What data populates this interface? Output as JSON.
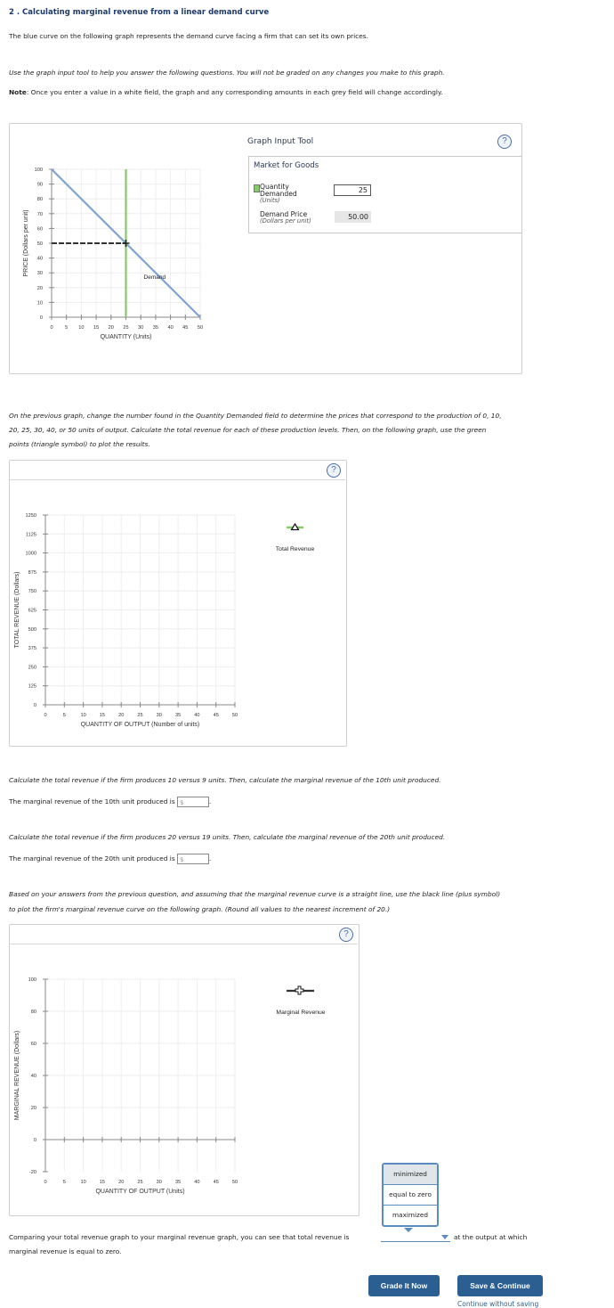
{
  "header": {
    "title": "2 . Calculating marginal revenue from a linear demand curve",
    "intro": "The blue curve on the following graph represents the demand curve facing a firm that can set its own prices.",
    "instruction": "Use the graph input tool to help you answer the following questions. You will not be graded on any changes you make to this graph.",
    "note_label": "Note",
    "note_text": ": Once you enter a value in a white field, the graph and any corresponding amounts in each grey field will change accordingly."
  },
  "graph_input_tool": {
    "title": "Graph Input Tool",
    "help": "?",
    "market_title": "Market for Goods",
    "quantity_label": "Quantity",
    "quantity_label2": "Demanded",
    "quantity_unit": "(Units)",
    "quantity_value": "25",
    "price_label": "Demand Price",
    "price_unit": "(Dollars per unit)",
    "price_value": "50.00"
  },
  "task2_text": {
    "line1": "On the previous graph, change the number found in the Quantity Demanded field to determine the prices that correspond to the production of 0, 10,",
    "line2": "20, 25, 30, 40, or 50 units of output. Calculate the total revenue for each of these production levels. Then, on the following graph, use the green",
    "line3": "points (triangle symbol) to plot the results."
  },
  "q10": {
    "prompt": "Calculate the total revenue if the firm produces 10 versus 9 units. Then, calculate the marginal revenue of the 10th unit produced.",
    "answer_label": "The marginal revenue of the 10th unit produced is",
    "prefix": "$",
    "value": "",
    "suffix": "."
  },
  "q20": {
    "prompt": "Calculate the total revenue if the firm produces 20 versus 19 units. Then, calculate the marginal revenue of the 20th unit produced.",
    "answer_label": "The marginal revenue of the 20th unit produced is",
    "prefix": "$",
    "value": "",
    "suffix": "."
  },
  "mr_text": {
    "line1": "Based on your answers from the previous question, and assuming that the marginal revenue curve is a straight line, use the black line (plus symbol)",
    "line2": "to plot the firm's marginal revenue curve on the following graph. (Round all values to the nearest increment of 20.)"
  },
  "comparison": {
    "before": "Comparing your total revenue graph to your marginal revenue graph, you can see that total revenue is",
    "after": "at the output at which",
    "line2": "marginal revenue is equal to zero.",
    "selected": "",
    "options": [
      "minimized",
      "equal to zero",
      "maximized"
    ]
  },
  "buttons": {
    "grade": "Grade It Now",
    "save": "Save & Continue",
    "continue_link": "Continue without saving"
  },
  "help_icon": "?",
  "chart_data": [
    {
      "type": "line",
      "title": "",
      "xlabel": "QUANTITY (Units)",
      "ylabel": "PRICE (Dollars per unit)",
      "xlim": [
        0,
        50
      ],
      "ylim": [
        0,
        100
      ],
      "xticks": [
        0,
        5,
        10,
        15,
        20,
        25,
        30,
        35,
        40,
        45,
        50
      ],
      "yticks": [
        0,
        10,
        20,
        30,
        40,
        50,
        60,
        70,
        80,
        90,
        100
      ],
      "grid": true,
      "series": [
        {
          "name": "Demand",
          "color": "#7fa4d2",
          "x": [
            0,
            50
          ],
          "y": [
            100,
            0
          ],
          "label": "Demand",
          "label_at": [
            31,
            27
          ]
        }
      ],
      "marker": {
        "x": 25,
        "y": 50,
        "vline_color": "#86c96a",
        "dash_color": "#333333"
      }
    },
    {
      "type": "scatter",
      "title": "",
      "xlabel": "QUANTITY OF OUTPUT (Number of units)",
      "ylabel": "TOTAL REVENUE (Dollars)",
      "xlim": [
        0,
        50
      ],
      "ylim": [
        0,
        1250
      ],
      "xticks": [
        0,
        5,
        10,
        15,
        20,
        25,
        30,
        35,
        40,
        45,
        50
      ],
      "yticks": [
        0,
        125,
        250,
        375,
        500,
        625,
        750,
        875,
        1000,
        1125,
        1250
      ],
      "grid": true,
      "legend": [
        {
          "name": "Total Revenue",
          "symbol": "triangle",
          "color": "#86c96a"
        }
      ],
      "legend_position": "right",
      "series": []
    },
    {
      "type": "line",
      "title": "",
      "xlabel": "QUANTITY OF OUTPUT (Units)",
      "ylabel": "MARGINAL REVENUE (Dollars)",
      "xlim": [
        0,
        50
      ],
      "ylim": [
        -20,
        100
      ],
      "xticks": [
        0,
        5,
        10,
        15,
        20,
        25,
        30,
        35,
        40,
        45,
        50
      ],
      "yticks": [
        -20,
        0,
        20,
        40,
        60,
        80,
        100
      ],
      "grid": true,
      "legend": [
        {
          "name": "Marginal Revenue",
          "symbol": "plus",
          "color": "#333333"
        }
      ],
      "legend_position": "right",
      "series": []
    }
  ]
}
